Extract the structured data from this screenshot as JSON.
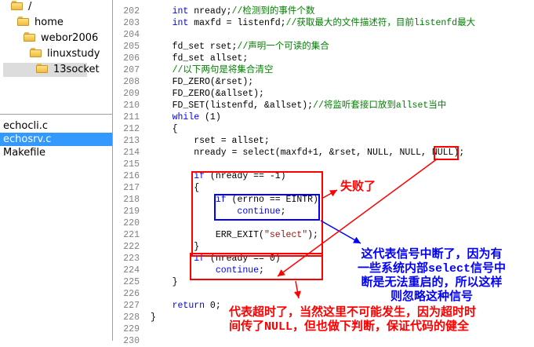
{
  "tree": {
    "items": [
      {
        "label": "/",
        "indent": 0
      },
      {
        "label": "home",
        "indent": 1
      },
      {
        "label": "webor2006",
        "indent": 2
      },
      {
        "label": "linuxstudy",
        "indent": 3
      },
      {
        "label": "13socket",
        "indent": 4,
        "selected": true
      }
    ]
  },
  "files": [
    {
      "name": "echocli.c",
      "selected": false
    },
    {
      "name": "echosrv.c",
      "selected": true
    },
    {
      "name": "Makefile",
      "selected": false
    }
  ],
  "code": {
    "first_line": 202,
    "lines": [
      [
        [
          "    ",
          ""
        ],
        [
          "int",
          "kw"
        ],
        [
          " nready;",
          ""
        ],
        [
          "//检测到的事件个数",
          "cm"
        ]
      ],
      [
        [
          "    ",
          ""
        ],
        [
          "int",
          "kw"
        ],
        [
          " maxfd = listenfd;",
          ""
        ],
        [
          "//获取最大的文件描述符，目前listenfd最大",
          "cm"
        ]
      ],
      [],
      [
        [
          "    fd_set rset;",
          ""
        ],
        [
          "//声明一个可读的集合",
          "cm"
        ]
      ],
      [
        [
          "    fd_set allset;",
          ""
        ]
      ],
      [
        [
          "    ",
          ""
        ],
        [
          "//以下两句是将集合清空",
          "cm"
        ]
      ],
      [
        [
          "    FD_ZERO(&rset);",
          ""
        ]
      ],
      [
        [
          "    FD_ZERO(&allset);",
          ""
        ]
      ],
      [
        [
          "    FD_SET(listenfd, &allset);",
          ""
        ],
        [
          "//将监听套接口放到allset当中",
          "cm"
        ]
      ],
      [
        [
          "    ",
          ""
        ],
        [
          "while",
          "kw"
        ],
        [
          " (1)",
          ""
        ]
      ],
      [
        [
          "    {",
          ""
        ]
      ],
      [
        [
          "        rset = allset;",
          ""
        ]
      ],
      [
        [
          "        nready = select(maxfd+1, &rset, NULL, NULL, NULL);",
          ""
        ]
      ],
      [],
      [
        [
          "        ",
          ""
        ],
        [
          "if",
          "kw"
        ],
        [
          " (nready == -1)",
          ""
        ]
      ],
      [
        [
          "        {",
          ""
        ]
      ],
      [
        [
          "            ",
          ""
        ],
        [
          "if",
          "kw"
        ],
        [
          " (errno == EINTR)",
          ""
        ]
      ],
      [
        [
          "                ",
          ""
        ],
        [
          "continue",
          "kw"
        ],
        [
          ";",
          ""
        ]
      ],
      [],
      [
        [
          "            ERR_EXIT(",
          ""
        ],
        [
          "\"select\"",
          "st"
        ],
        [
          ");",
          ""
        ]
      ],
      [
        [
          "        }",
          ""
        ]
      ],
      [
        [
          "        ",
          ""
        ],
        [
          "if",
          "kw"
        ],
        [
          " (nready == 0)",
          ""
        ]
      ],
      [
        [
          "            ",
          ""
        ],
        [
          "continue",
          "kw"
        ],
        [
          ";",
          ""
        ]
      ],
      [
        [
          "    }",
          ""
        ]
      ],
      [],
      [
        [
          "    ",
          ""
        ],
        [
          "return",
          "kw"
        ],
        [
          " 0;",
          ""
        ]
      ],
      [
        [
          "}",
          ""
        ]
      ],
      [],
      []
    ]
  },
  "annotations": {
    "fail": "失败了",
    "interrupt": "这代表信号中断了，因为有\n一些系统内部select信号中\n断是无法重启的，所以这样\n则忽略这种信号",
    "timeout": "代表超时了，当然这里不可能发生，因为超时时\n间传了NULL，但也做下判断，保证代码的健全"
  },
  "colors": {
    "highlight_red": "#ff0000",
    "highlight_blue": "#0000ff",
    "annotation_red": "#ff0000",
    "annotation_blue": "#0000ff",
    "selected_file": "#3399ff"
  }
}
